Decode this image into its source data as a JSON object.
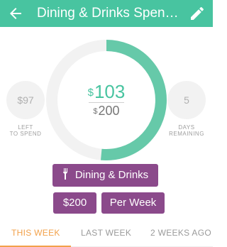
{
  "header": {
    "title": "Dining & Drinks Spending",
    "back_icon": "arrow-back-icon",
    "edit_icon": "pencil-icon",
    "color": "#48c4a0"
  },
  "summary": {
    "spent_currency": "$",
    "spent_amount": "103",
    "budget_currency": "$",
    "budget_amount": "200",
    "spent_fraction": 0.515,
    "ring_track_color": "#f2f2f2",
    "ring_progress_color": "#66c9a9"
  },
  "left_stat": {
    "value": "$97",
    "label_line1": "LEFT",
    "label_line2": "TO SPEND"
  },
  "right_stat": {
    "value": "5",
    "label_line1": "DAYS",
    "label_line2": "REMAINING"
  },
  "category_button": {
    "label": "Dining & Drinks",
    "icon": "fork-knife-icon",
    "color": "#8b4a8b"
  },
  "amount_button": {
    "label": "$200"
  },
  "period_button": {
    "label": "Per Week"
  },
  "tabs": [
    {
      "label": "THIS WEEK",
      "active": true
    },
    {
      "label": "LAST WEEK",
      "active": false
    },
    {
      "label": "2 WEEKS AGO",
      "active": false
    }
  ],
  "accent_color": "#f2a14a"
}
